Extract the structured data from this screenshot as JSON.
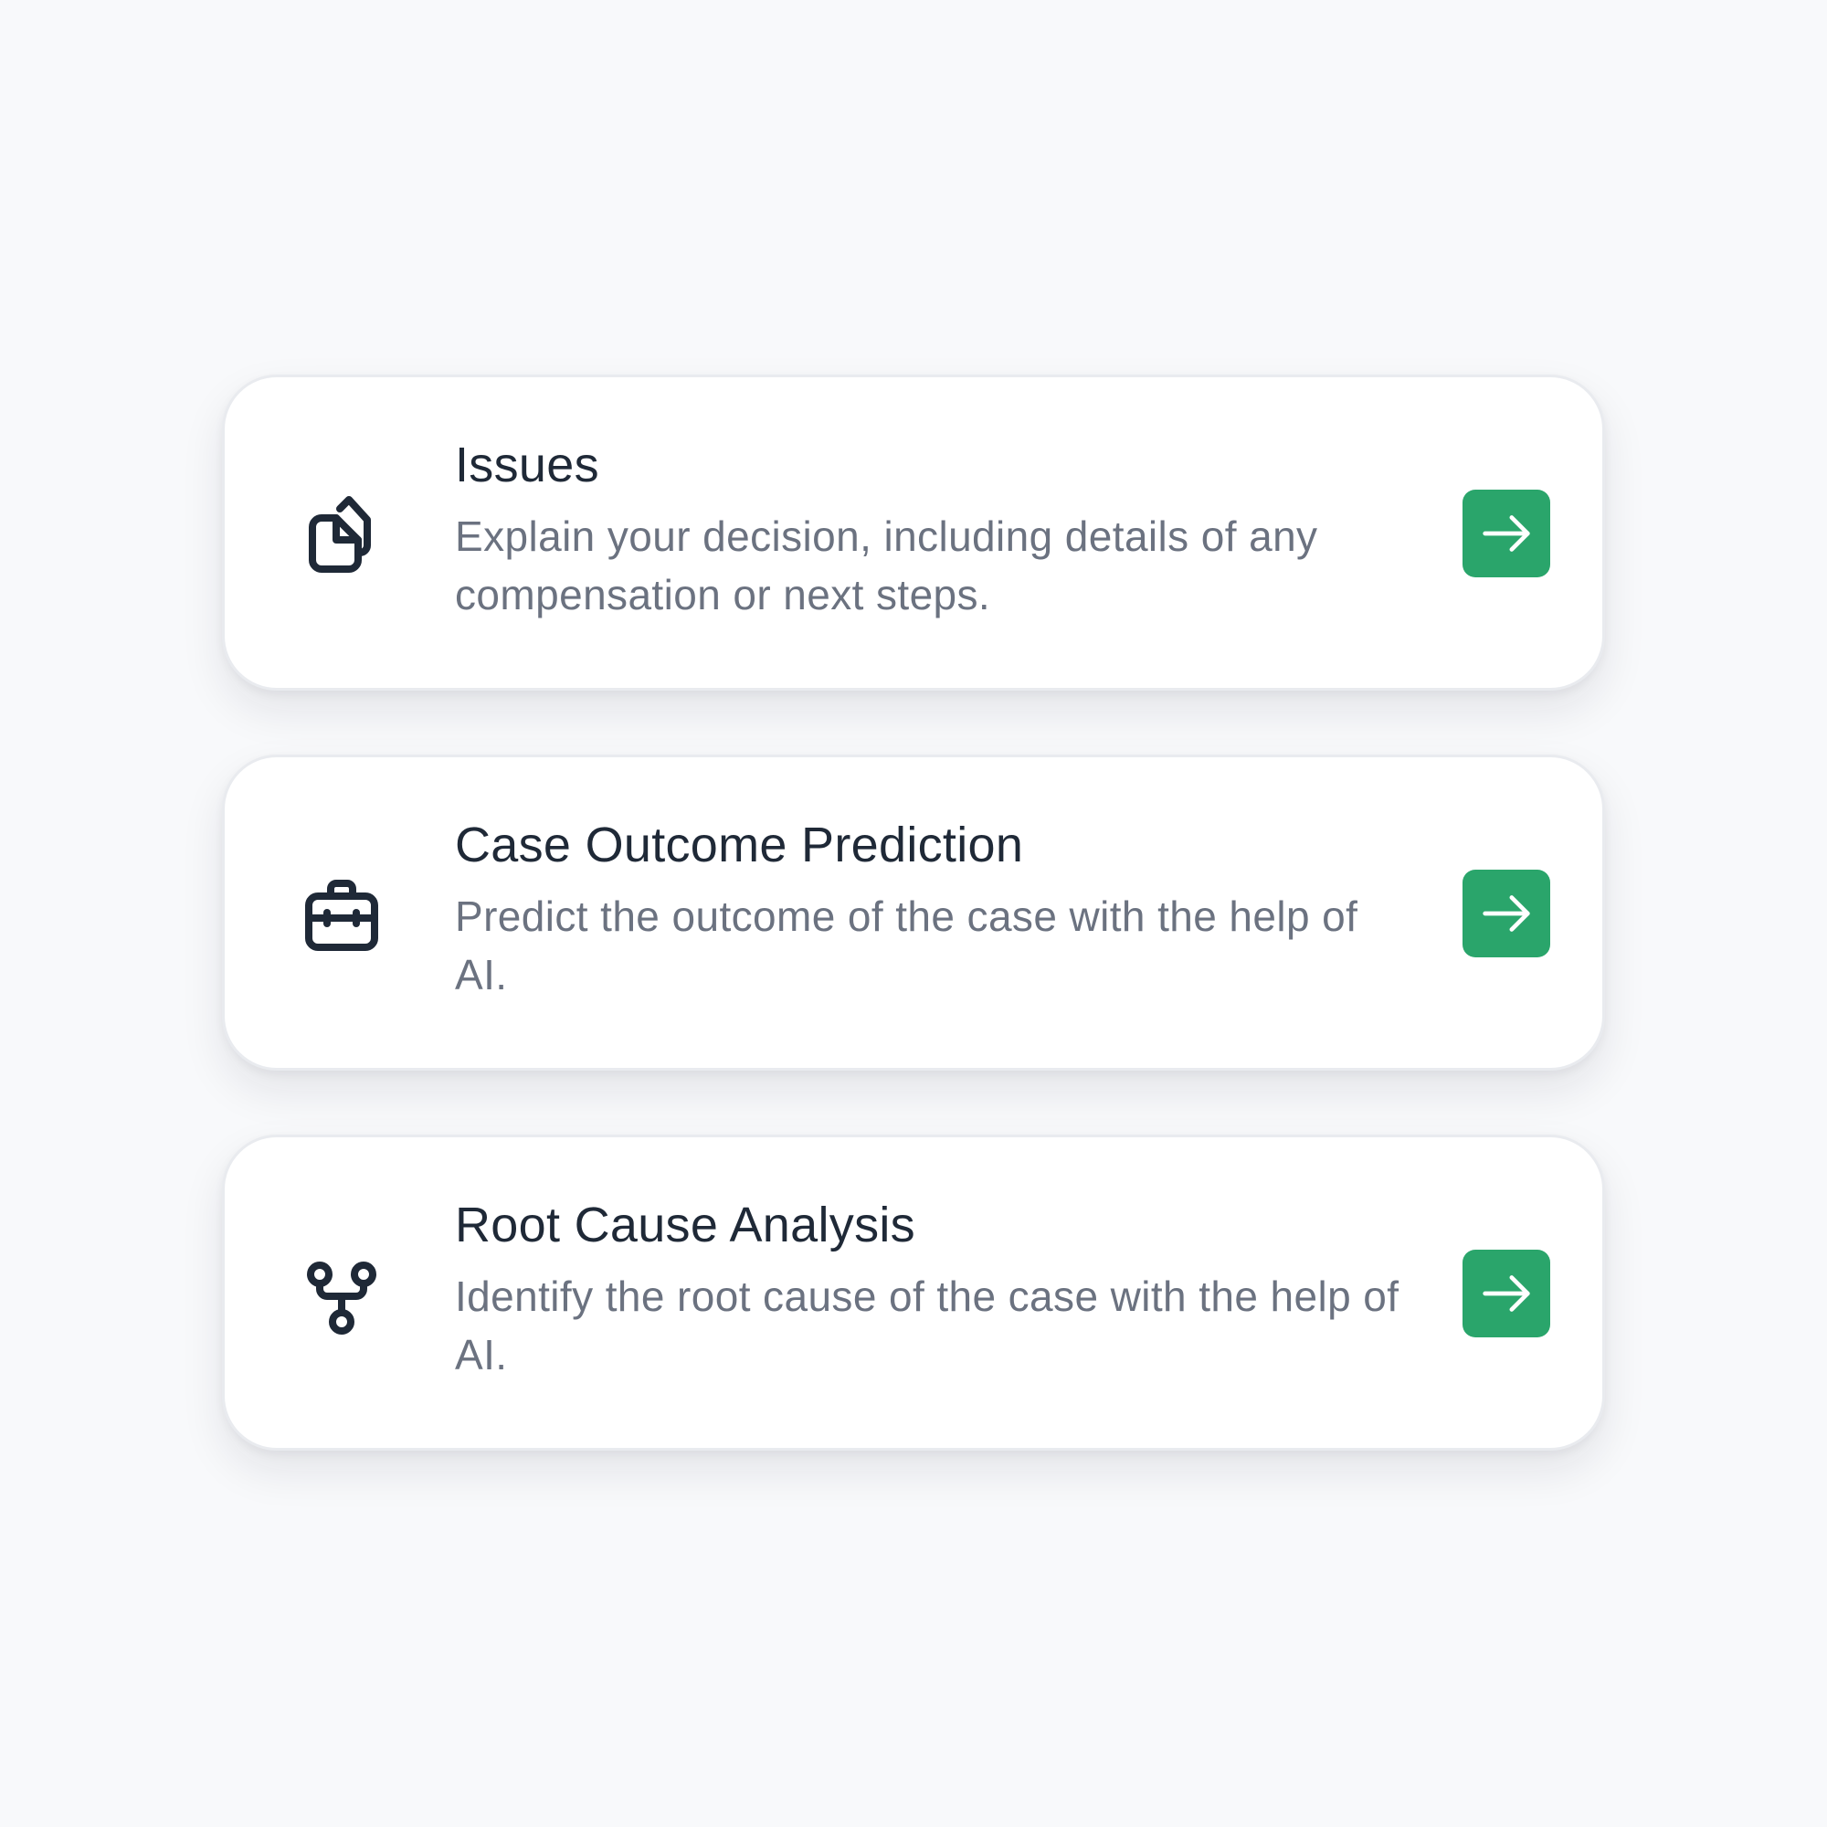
{
  "theme": {
    "background": "#f8f9fb",
    "card_background": "#ffffff",
    "title_color": "#1f2937",
    "description_color": "#6b7280",
    "icon_color": "#1f2937",
    "accent": "#2aa56b"
  },
  "cards": [
    {
      "icon": "documents-icon",
      "title": "Issues",
      "description": "Explain your decision, including details of any compensation or next steps.",
      "action_icon": "arrow-right-icon"
    },
    {
      "icon": "briefcase-icon",
      "title": "Case Outcome Prediction",
      "description": "Predict the outcome of the case with the help of AI.",
      "action_icon": "arrow-right-icon"
    },
    {
      "icon": "git-fork-icon",
      "title": "Root Cause Analysis",
      "description": "Identify the root cause of the case with the help of AI.",
      "action_icon": "arrow-right-icon"
    }
  ]
}
